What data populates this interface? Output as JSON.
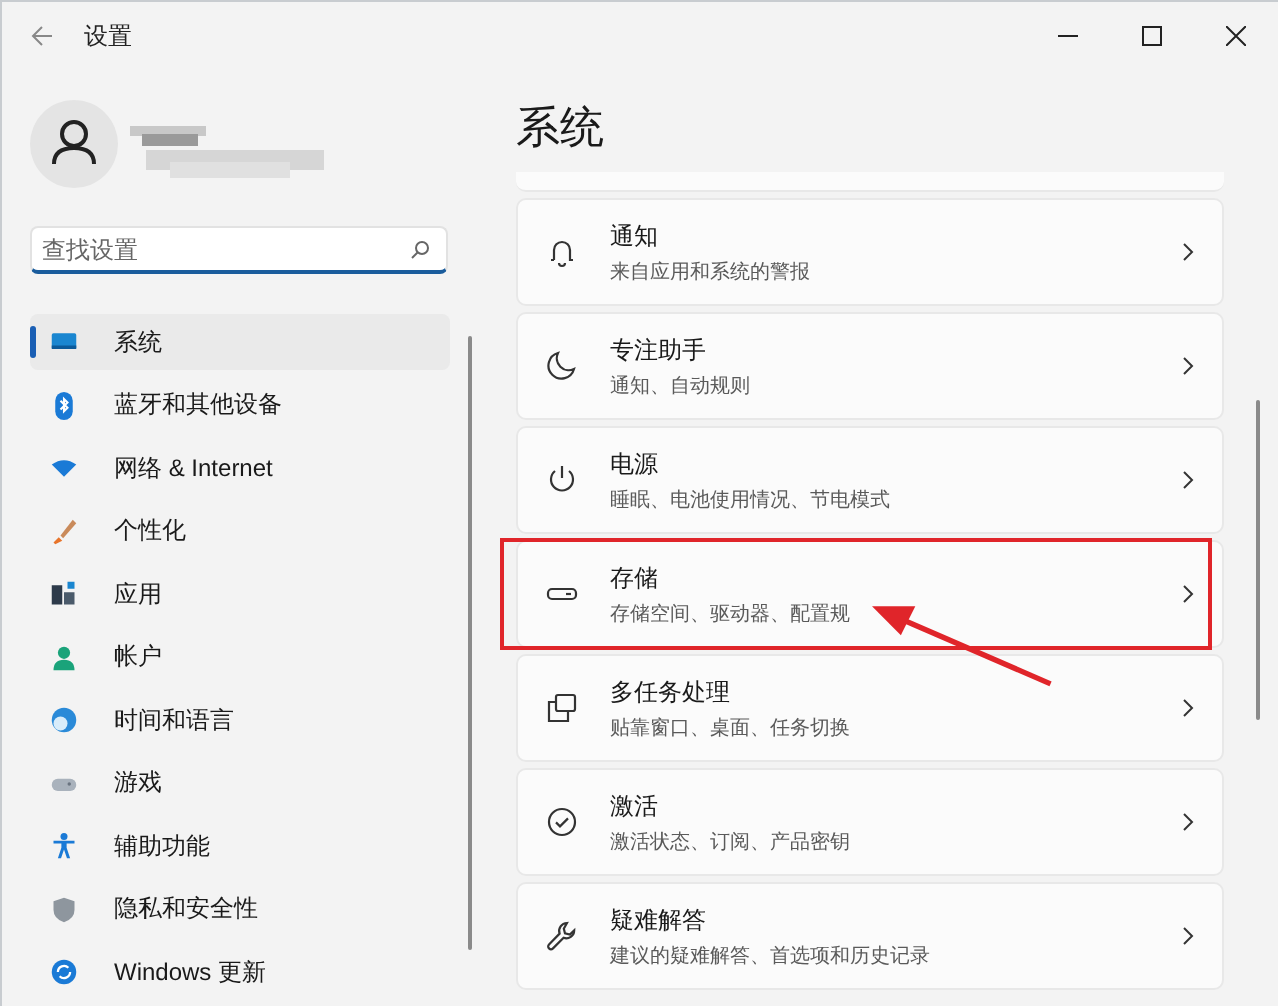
{
  "window": {
    "title": "设置"
  },
  "search": {
    "placeholder": "查找设置"
  },
  "nav": [
    {
      "label": "系统",
      "selected": true
    },
    {
      "label": "蓝牙和其他设备",
      "selected": false
    },
    {
      "label": "网络 & Internet",
      "selected": false
    },
    {
      "label": "个性化",
      "selected": false
    },
    {
      "label": "应用",
      "selected": false
    },
    {
      "label": "帐户",
      "selected": false
    },
    {
      "label": "时间和语言",
      "selected": false
    },
    {
      "label": "游戏",
      "selected": false
    },
    {
      "label": "辅助功能",
      "selected": false
    },
    {
      "label": "隐私和安全性",
      "selected": false
    },
    {
      "label": "Windows 更新",
      "selected": false
    }
  ],
  "page_title": "系统",
  "cards": [
    {
      "title": "通知",
      "subtitle": "来自应用和系统的警报",
      "highlighted": false
    },
    {
      "title": "专注助手",
      "subtitle": "通知、自动规则",
      "highlighted": false
    },
    {
      "title": "电源",
      "subtitle": "睡眠、电池使用情况、节电模式",
      "highlighted": false
    },
    {
      "title": "存储",
      "subtitle": "存储空间、驱动器、配置规",
      "highlighted": true
    },
    {
      "title": "多任务处理",
      "subtitle": "贴靠窗口、桌面、任务切换",
      "highlighted": false
    },
    {
      "title": "激活",
      "subtitle": "激活状态、订阅、产品密钥",
      "highlighted": false
    },
    {
      "title": "疑难解答",
      "subtitle": "建议的疑难解答、首选项和历史记录",
      "highlighted": false
    }
  ]
}
